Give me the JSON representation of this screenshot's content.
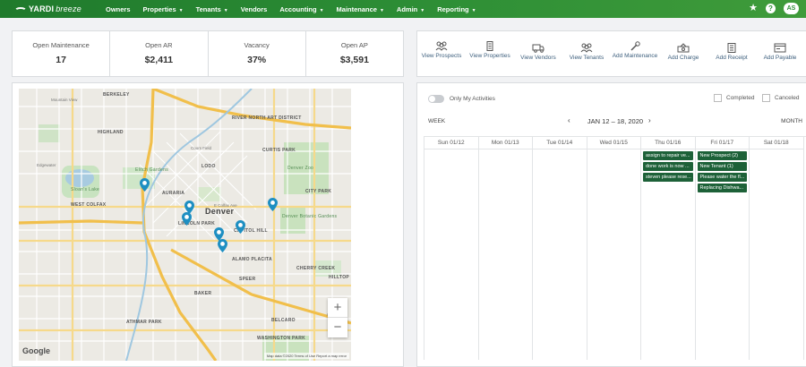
{
  "brand": {
    "name": "YARDI",
    "product": "breeze"
  },
  "nav": [
    {
      "label": "Owners",
      "dropdown": false
    },
    {
      "label": "Properties",
      "dropdown": true
    },
    {
      "label": "Tenants",
      "dropdown": true
    },
    {
      "label": "Vendors",
      "dropdown": false
    },
    {
      "label": "Accounting",
      "dropdown": true
    },
    {
      "label": "Maintenance",
      "dropdown": true
    },
    {
      "label": "Admin",
      "dropdown": true
    },
    {
      "label": "Reporting",
      "dropdown": true
    }
  ],
  "user": {
    "initials": "AS"
  },
  "stats": [
    {
      "label": "Open Maintenance",
      "value": "17"
    },
    {
      "label": "Open AR",
      "value": "$2,411"
    },
    {
      "label": "Vacancy",
      "value": "37%"
    },
    {
      "label": "Open AP",
      "value": "$3,591"
    }
  ],
  "actions": [
    {
      "label": "View Prospects",
      "icon": "people-icon"
    },
    {
      "label": "View Properties",
      "icon": "building-icon"
    },
    {
      "label": "View Vendors",
      "icon": "truck-icon"
    },
    {
      "label": "View Tenants",
      "icon": "people-icon"
    },
    {
      "label": "Add Maintenance",
      "icon": "wrench-icon"
    },
    {
      "label": "Add Charge",
      "icon": "money-icon"
    },
    {
      "label": "Add Receipt",
      "icon": "receipt-icon"
    },
    {
      "label": "Add Payable",
      "icon": "payable-icon"
    }
  ],
  "map": {
    "labels": [
      "BERKELEY",
      "Mountain View",
      "HIGHLAND",
      "RIVER NORTH ART DISTRICT",
      "CURTIS PARK",
      "Coors Field",
      "LODO",
      "Elitch Gardens",
      "Edgewater",
      "Sloan's Lake",
      "AURARIA",
      "Denver",
      "Denver Zoo",
      "CITY PARK",
      "WEST COLFAX",
      "Denver Botanic Gardens",
      "LINCOLN PARK",
      "CAPITOL HILL",
      "ALAMO PLACITA",
      "CHERRY CREEK",
      "SPEER",
      "BAKER",
      "HILLTOP",
      "ATHMAR PARK",
      "BELCARO",
      "WASHINGTON PARK",
      "Glendale",
      "E Colfax Ave"
    ],
    "zoom_in": "+",
    "zoom_out": "−",
    "provider": "Google",
    "attribution": "Map data ©2020   Terms of Use   Report a map error"
  },
  "calendar": {
    "toggle_label": "Only My Activities",
    "completed_label": "Completed",
    "canceled_label": "Canceled",
    "week_label": "WEEK",
    "month_label": "MONTH",
    "range": "JAN 12 – 18, 2020",
    "prev": "‹",
    "next": "›",
    "days": [
      {
        "label": "Sun 01/12",
        "events": []
      },
      {
        "label": "Mon 01/13",
        "events": []
      },
      {
        "label": "Tue 01/14",
        "events": []
      },
      {
        "label": "Wed 01/15",
        "events": []
      },
      {
        "label": "Thu 01/16",
        "events": [
          "assign to repair ve...",
          "done work is now ...",
          "steven please rese..."
        ]
      },
      {
        "label": "Fri 01/17",
        "events": [
          "New Prospect (2)",
          "New Tenant (1)",
          "Please water the fl...",
          "Replacing Dishwa..."
        ]
      },
      {
        "label": "Sat 01/18",
        "events": []
      }
    ]
  },
  "colors": {
    "brand_green": "#2e8f36",
    "event_green": "#1d6138",
    "pin": "#1e8fc2",
    "link_blue": "#3d5f7d"
  }
}
